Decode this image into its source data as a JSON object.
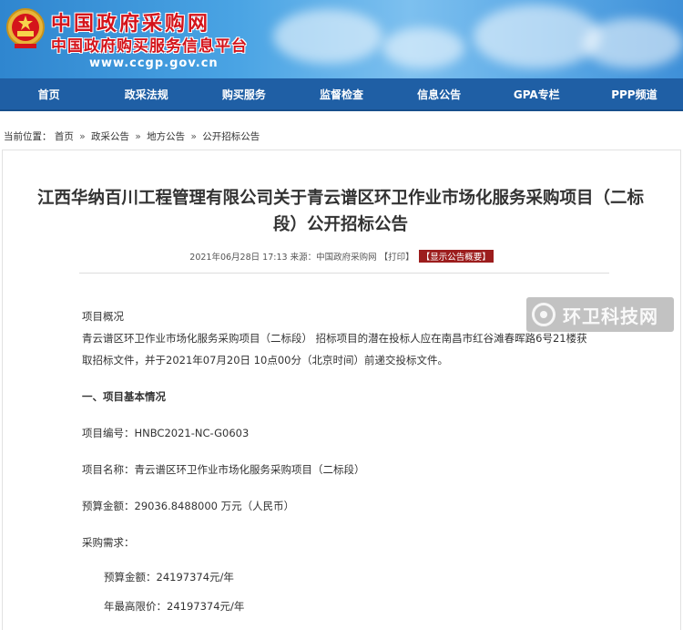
{
  "header": {
    "title": "中国政府采购网",
    "subtitle": "中国政府购买服务信息平台",
    "url": "www.ccgp.gov.cn"
  },
  "nav": {
    "items": [
      "首页",
      "政采法规",
      "购买服务",
      "监督检查",
      "信息公告",
      "GPA专栏",
      "PPP频道"
    ]
  },
  "breadcrumb": {
    "prefix": "当前位置：",
    "items": [
      "首页",
      "政采公告",
      "地方公告",
      "公开招标公告"
    ],
    "separator": "»"
  },
  "article": {
    "title_line1": "江西华纳百川工程管理有限公司关于青云谱区环卫作业市场化服务采购项目（二标",
    "title_line2": "段）公开招标公告",
    "meta_date": "2021年06月28日 17:13",
    "meta_source": "来源：中国政府采购网",
    "meta_print": "【打印】",
    "meta_summary": "【显示公告概要】",
    "overview_heading": "项目概况",
    "overview_line1": "青云谱区环卫作业市场化服务采购项目（二标段） 招标项目的潜在投标人应在南昌市红谷滩春晖路6号21楼获",
    "overview_line2": "取招标文件，并于2021年07月20日 10点00分（北京时间）前递交投标文件。",
    "section1_heading": "一、项目基本情况",
    "project_no": "项目编号：HNBC2021-NC-G0603",
    "project_name": "项目名称：青云谱区环卫作业市场化服务采购项目（二标段）",
    "budget": "预算金额：29036.8488000 万元（人民币）",
    "demand_heading": "采购需求：",
    "demand_budget": "预算金额：24197374元/年",
    "demand_max": "年最高限价：24197374元/年"
  },
  "watermark": {
    "text": "环卫科技网"
  },
  "colors": {
    "nav_bg": "#1f5fa5",
    "title_red": "#d4141b",
    "summary_tag": "#9c1d1d"
  }
}
